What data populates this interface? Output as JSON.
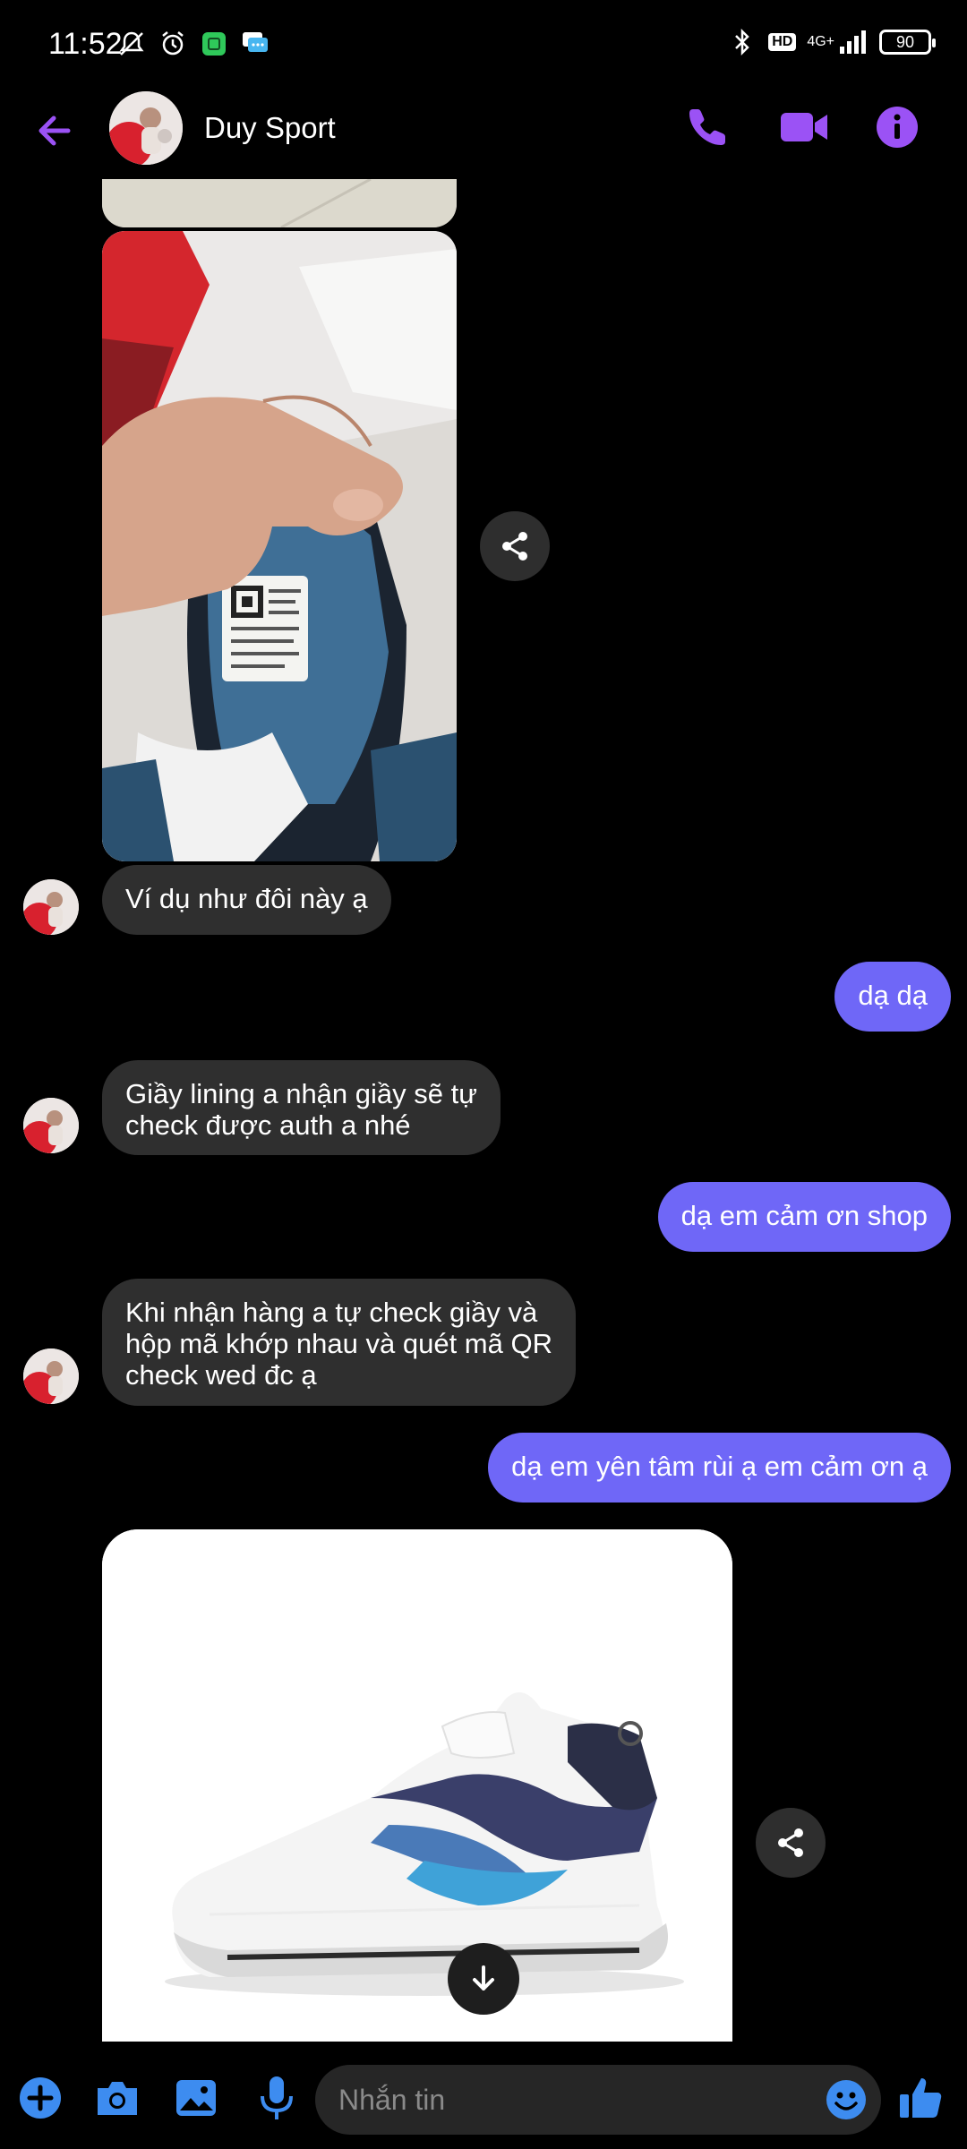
{
  "status_bar": {
    "time": "11:52",
    "network": "4G+",
    "hd_badge": "HD",
    "battery": "90"
  },
  "header": {
    "contact_name": "Duy Sport"
  },
  "messages": [
    {
      "side": "in",
      "text": "Ví dụ như đôi này ạ"
    },
    {
      "side": "out",
      "text": "dạ dạ"
    },
    {
      "side": "in",
      "text": "Giầy lining a nhận giầy sẽ tự\ncheck được auth a nhé"
    },
    {
      "side": "out",
      "text": "dạ em cảm ơn shop"
    },
    {
      "side": "in",
      "text": "Khi nhận hàng a tự check giầy và\nhộp mã khớp nhau và quét mã QR\ncheck wed đc ạ"
    },
    {
      "side": "out",
      "text": "dạ em yên tâm rùi ạ em cảm ơn ạ"
    }
  ],
  "composer": {
    "placeholder": "Nhắn tin"
  },
  "colors": {
    "accent": "#9b52f5",
    "outgoing_bubble": "#6f67f7",
    "incoming_bubble": "#2f2f2f",
    "composer_blue": "#3d8cf0"
  },
  "icons": [
    "back-arrow-icon",
    "phone-icon",
    "video-icon",
    "info-icon",
    "share-icon",
    "arrow-down-icon",
    "plus-icon",
    "camera-icon",
    "gallery-icon",
    "mic-icon",
    "emoji-icon",
    "thumbs-up-icon"
  ]
}
